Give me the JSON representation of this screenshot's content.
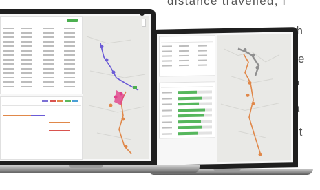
{
  "background_copy": {
    "line1": "distance travelled, i",
    "line2": "veh",
    "line3": "We",
    "line4": "yo",
    "line5": "ca",
    "line6": "wit"
  },
  "colors": {
    "accent_green": "#4caf50",
    "route_purple": "#6b5bd6",
    "route_orange": "#e0884a",
    "route_pink": "#e0408a",
    "laptop_frame": "#1f1f1f"
  },
  "left_screen": {
    "top_button": "green-button",
    "legend_colors": [
      "#7b6fd4",
      "#d9534f",
      "#e0884a",
      "#5cb85c",
      "#4a9fd5"
    ]
  },
  "right_screen": {
    "progress_bars": [
      0.55,
      0.7,
      0.62,
      0.8,
      0.75,
      0.68,
      0.72,
      0.6
    ]
  }
}
